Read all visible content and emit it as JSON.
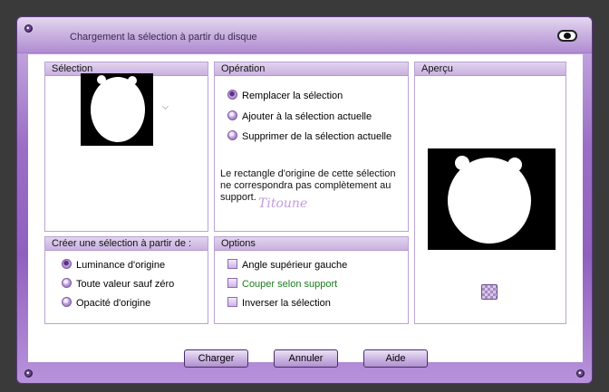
{
  "window": {
    "title": "Chargement la sélection à partir du disque"
  },
  "groups": {
    "selection": {
      "label": "Sélection"
    },
    "operation": {
      "label": "Opération",
      "options": [
        {
          "label": "Remplacer la sélection",
          "selected": true
        },
        {
          "label": "Ajouter à la sélection actuelle",
          "selected": false
        },
        {
          "label": "Supprimer de la sélection actuelle",
          "selected": false
        }
      ],
      "info": "Le rectangle d'origine de cette sélection ne correspondra pas complètement au support.",
      "signature": "Titoune"
    },
    "preview": {
      "label": "Aperçu"
    },
    "create": {
      "label": "Créer une sélection à partir de :",
      "options": [
        {
          "label": "Luminance d'origine",
          "selected": true
        },
        {
          "label": "Toute valeur sauf zéro",
          "selected": false
        },
        {
          "label": "Opacité d'origine",
          "selected": false
        }
      ]
    },
    "options": {
      "label": "Options",
      "checks": [
        {
          "label": "Angle supérieur gauche",
          "checked": false
        },
        {
          "label": "Couper selon support",
          "checked": false,
          "color": "#1a7d1a"
        },
        {
          "label": "Inverser la sélection",
          "checked": false
        }
      ]
    }
  },
  "buttons": {
    "load": "Charger",
    "cancel": "Annuler",
    "help": "Aide"
  },
  "icons": {
    "close": "eye-toggle-icon",
    "preview_toggle": "checker-preview-icon"
  }
}
